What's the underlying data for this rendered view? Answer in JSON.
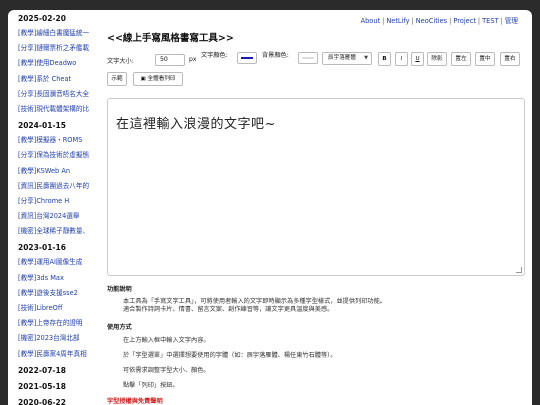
{
  "sidebar": {
    "groups": [
      {
        "date": "2025-02-20",
        "items": [
          "[教學]繪細白書魔猛統一",
          "[分享]鏈爾票析之矛艦載",
          "[教學]使用Deadwo",
          "[教學]系於 Cheat",
          "[分享]長固瀰音唔名大全",
          "[技術]現代載體架構的比"
        ]
      },
      {
        "date": "2024-01-15",
        "items": [
          "[教學]模擬器・ROMS",
          "[分享]保為技術於虛擬態",
          "[教學]KSWeb An",
          "[資訊]民壽團過去八年的",
          "[分享]Chrome H",
          "[資訊]台灣2024選舉",
          "[機密]全球稀子靜數量、"
        ]
      },
      {
        "date": "2023-01-16",
        "items": [
          "[教學]運用AI圖像生成",
          "[教學]3ds Max",
          "[教學]遊後支援sse2",
          "[技術]LibreOff",
          "[教學]上帝存在的證明",
          "[機密]2023台灣北部",
          "[教學]民壽黨4周年真相"
        ]
      },
      {
        "date": "2022-07-18",
        "items": []
      },
      {
        "date": "2021-05-18",
        "items": []
      },
      {
        "date": "2020-06-22",
        "items": []
      }
    ]
  },
  "nav": {
    "links": [
      "About",
      "NetLify",
      "NeoCities",
      "Project",
      "TEST",
      "管理"
    ]
  },
  "page": {
    "title": "<<線上手寫風格書寫工具>>"
  },
  "toolbar": {
    "font_size_label": "文字大小:",
    "font_size_value": "50",
    "font_size_unit": "px",
    "text_color_label": "文字顏色:",
    "text_color": "#1a1ab8",
    "bg_color_label": "背景顏色:",
    "bg_color": "#ffffff",
    "font_select": "辰宇落雁體",
    "bold": "B",
    "italic": "I",
    "underline": "U",
    "erase": "除影",
    "left": "置左",
    "center": "置中",
    "right": "置右",
    "example": "示範",
    "print": "全體看列印"
  },
  "canvas": {
    "text": "在這裡輸入浪漫的文字吧~"
  },
  "content": {
    "intro_heading": "功能說明",
    "intro_lines": [
      "本工具為「手寫文字工具」，可將使用者輸入的文字即時顯示為多種字型樣式，並提供列印功能。",
      "適合製作詩詞卡片、情書、留言文案、創作練習等，讓文字更具溫度與美感。"
    ],
    "usage_heading": "使用方式",
    "usage_lines": [
      "在上方輸入框中輸入文字內容。",
      "於「字型選單」中選擇想要使用的字體（如：辰宇落雁體、楊任東竹石體等）。",
      "可依需求調整字型大小、顏色。",
      "點擊「列印」按鈕。"
    ],
    "footer_red": "字型授權與免責聲明"
  }
}
